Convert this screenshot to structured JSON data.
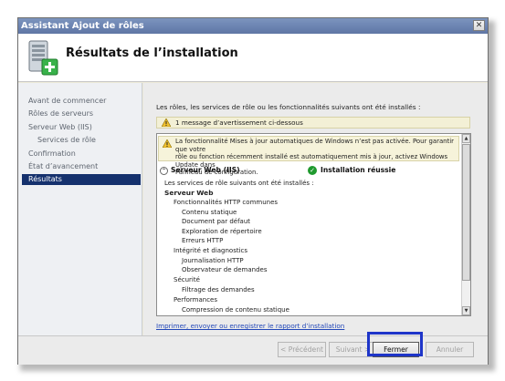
{
  "window": {
    "title": "Assistant Ajout de rôles",
    "close_glyph": "✕"
  },
  "header": {
    "title": "Résultats de l’installation",
    "icon": "server-add-icon"
  },
  "sidebar": {
    "items": [
      {
        "label": "Avant de commencer"
      },
      {
        "label": "Rôles de serveurs"
      },
      {
        "label": "Serveur Web (IIS)"
      },
      {
        "label": "Services de rôle"
      },
      {
        "label": "Confirmation"
      },
      {
        "label": "État d’avancement"
      },
      {
        "label": "Résultats"
      }
    ],
    "active": "Résultats"
  },
  "main": {
    "intro": "Les rôles, les services de rôle ou les fonctionnalités suivants ont été installés :",
    "warning_summary": "1 message d’avertissement ci-dessous",
    "warning_lines": [
      "La fonctionnalité Mises à jour automatiques de Windows n’est pas activée. Pour garantir que votre",
      "rôle ou fonction récemment installé est automatiquement mis à jour, activez Windows Update dans",
      "Panneau de configuration."
    ],
    "role_name": "Serveur Web (IIS)",
    "role_status": "Installation réussie",
    "tree": {
      "intro": "Les services de rôle suivants ont été installés :",
      "root": "Serveur Web",
      "groups": [
        {
          "label": "Fonctionnalités HTTP communes",
          "items": [
            "Contenu statique",
            "Document par défaut",
            "Exploration de répertoire",
            "Erreurs HTTP"
          ]
        },
        {
          "label": "Intégrité et diagnostics",
          "items": [
            "Journalisation HTTP",
            "Observateur de demandes"
          ]
        },
        {
          "label": "Sécurité",
          "items": [
            "Filtrage des demandes"
          ]
        },
        {
          "label": "Performances",
          "items": [
            "Compression de contenu statique"
          ]
        }
      ]
    },
    "report_link": "Imprimer, envoyer ou enregistrer le rapport d’installation"
  },
  "footer": {
    "prev": "< Précédent",
    "next": "Suivant >",
    "close": "Fermer",
    "cancel": "Annuler"
  },
  "colors": {
    "accent": "#15316d",
    "focus": "#1e35c9",
    "success": "#1f9a2e",
    "link": "#2247b8"
  }
}
